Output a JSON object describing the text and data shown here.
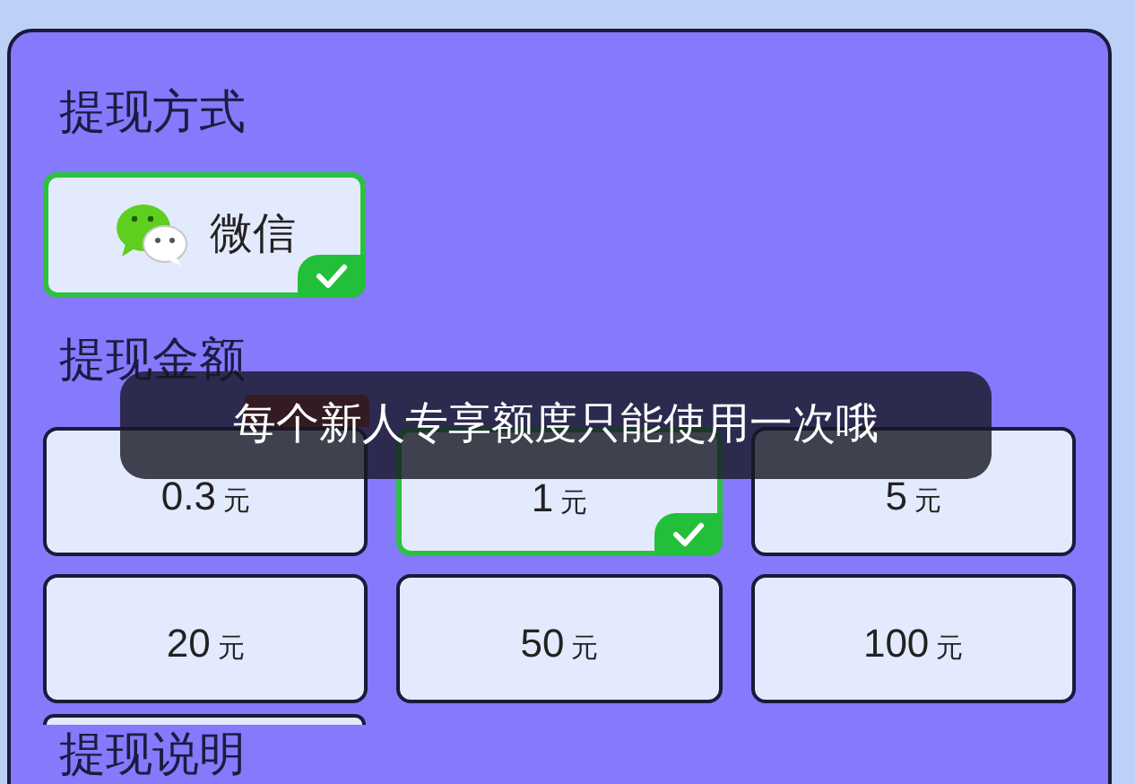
{
  "method_section": {
    "title": "提现方式",
    "options": [
      {
        "label": "微信",
        "selected": true
      }
    ]
  },
  "amount_section": {
    "title": "提现金额",
    "amounts": [
      {
        "value": "0.3",
        "unit": "元",
        "selected": false,
        "tag": true
      },
      {
        "value": "1",
        "unit": "元",
        "selected": true,
        "tag": false
      },
      {
        "value": "5",
        "unit": "元",
        "selected": false,
        "tag": false
      },
      {
        "value": "20",
        "unit": "元",
        "selected": false,
        "tag": false
      },
      {
        "value": "50",
        "unit": "元",
        "selected": false,
        "tag": false
      },
      {
        "value": "100",
        "unit": "元",
        "selected": false,
        "tag": false
      }
    ]
  },
  "notes_section": {
    "title": "提现说明"
  },
  "toast": {
    "message": "每个新人专享额度只能使用一次哦"
  }
}
